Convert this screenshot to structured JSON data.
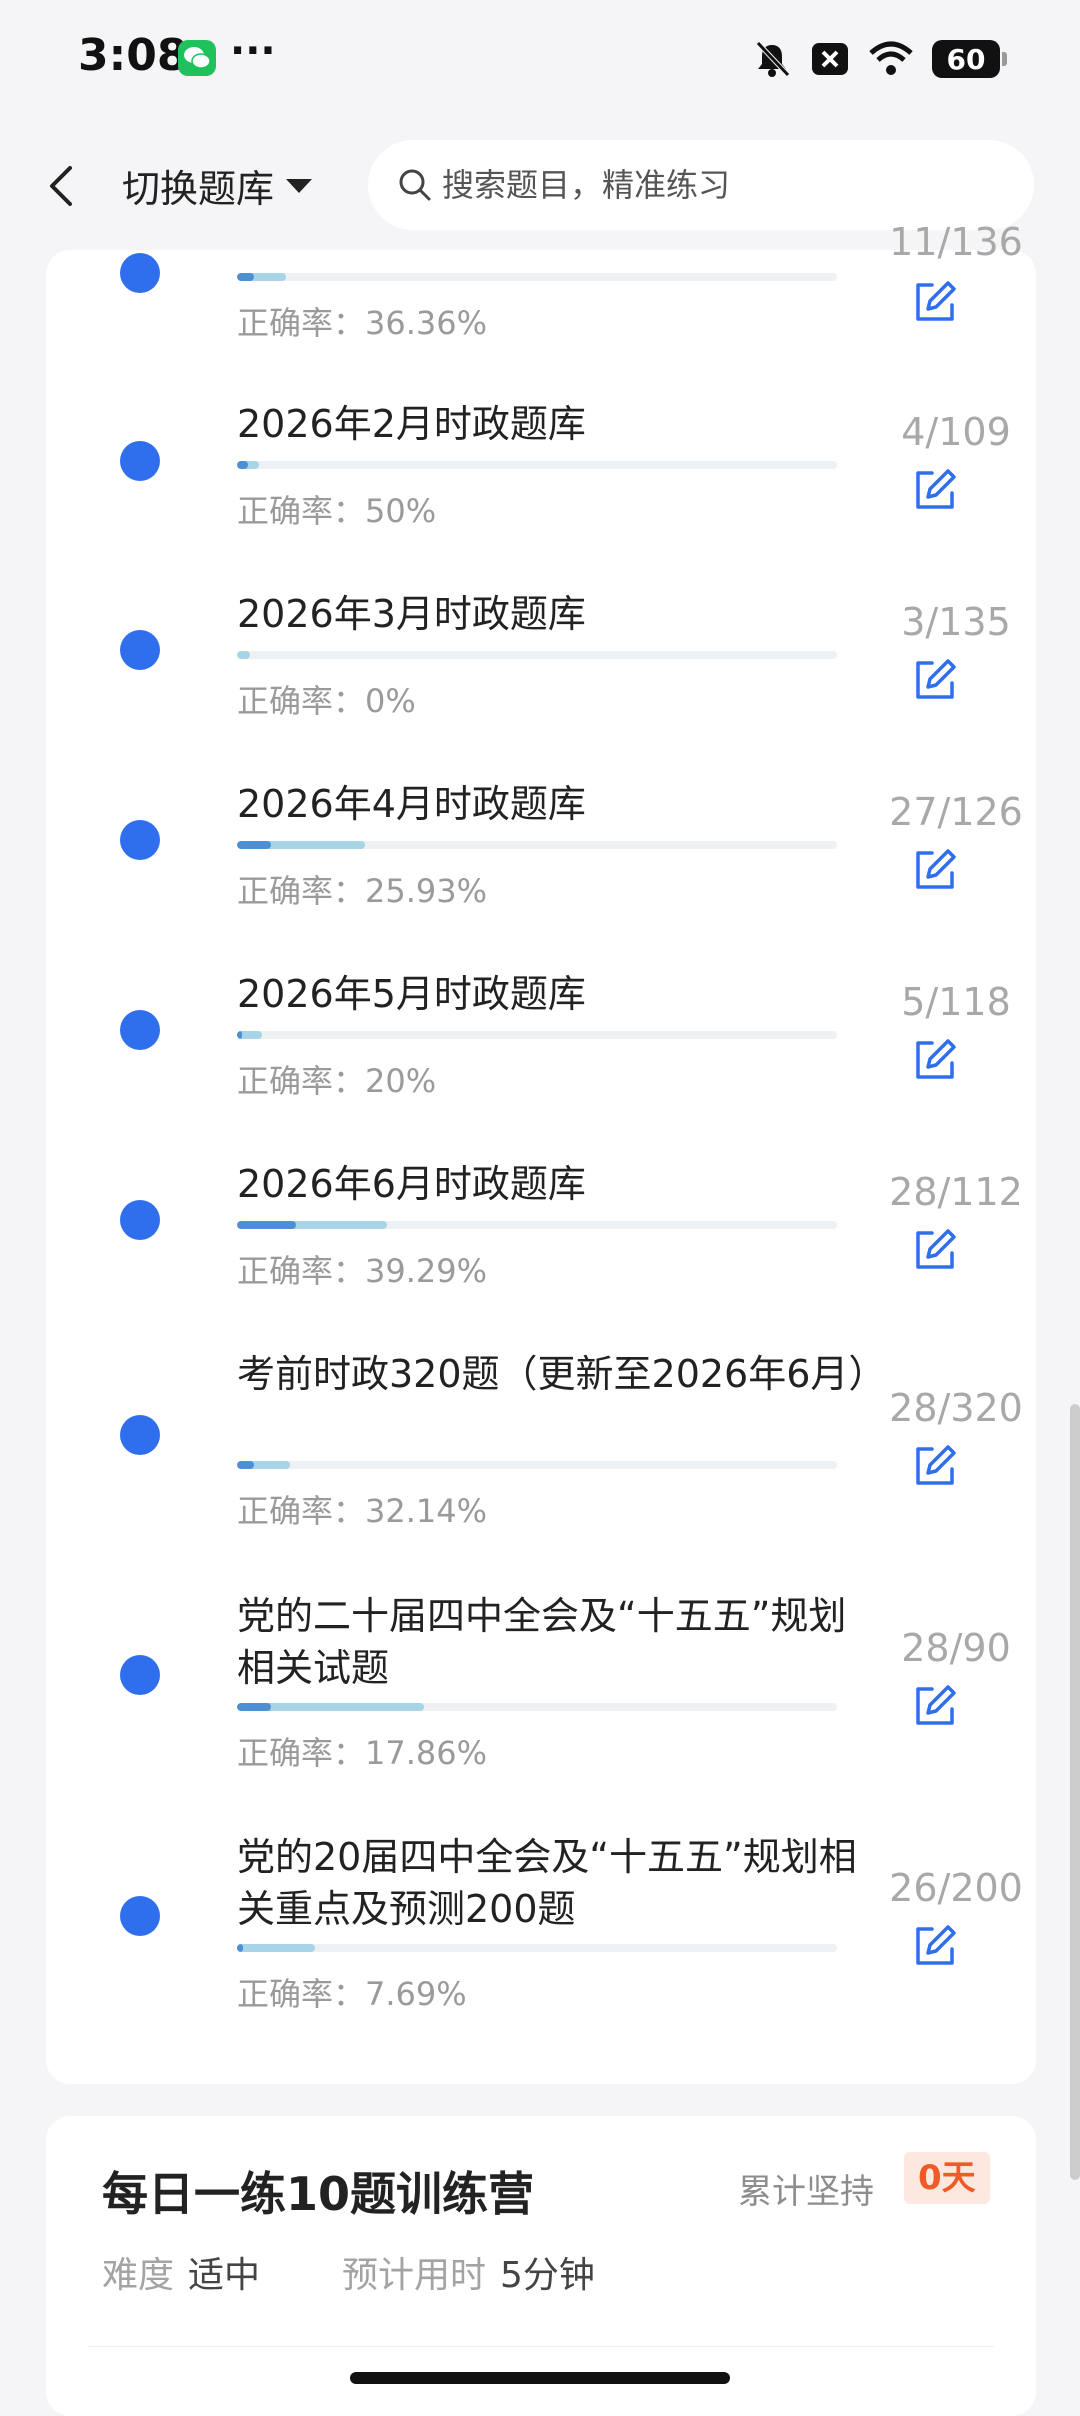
{
  "status_bar": {
    "time": "3:08",
    "more": "···",
    "battery": "60"
  },
  "header": {
    "back_icon": "chevron-left-icon",
    "switch_label": "切换题库",
    "search_placeholder": "搜索题目，精准练习"
  },
  "list": {
    "rate_prefix": "正确率：",
    "items": [
      {
        "title": "",
        "count": "11/136",
        "rate": "36.36%",
        "progress": 0.081,
        "correct": 0.029
      },
      {
        "title": "2026年2月时政题库",
        "count": "4/109",
        "rate": "50%",
        "progress": 0.037,
        "correct": 0.018
      },
      {
        "title": "2026年3月时政题库",
        "count": "3/135",
        "rate": "0%",
        "progress": 0.022,
        "correct": 0.0
      },
      {
        "title": "2026年4月时政题库",
        "count": "27/126",
        "rate": "25.93%",
        "progress": 0.214,
        "correct": 0.056
      },
      {
        "title": "2026年5月时政题库",
        "count": "5/118",
        "rate": "20%",
        "progress": 0.042,
        "correct": 0.008
      },
      {
        "title": "2026年6月时政题库",
        "count": "28/112",
        "rate": "39.29%",
        "progress": 0.25,
        "correct": 0.098
      },
      {
        "title": "考前时政320题（更新至2026年6月）",
        "count": "28/320",
        "rate": "32.14%",
        "progress": 0.0875,
        "correct": 0.028
      },
      {
        "title": "党的二十届四中全会及“十五五”规划相关试题",
        "count": "28/90",
        "rate": "17.86%",
        "progress": 0.311,
        "correct": 0.056
      },
      {
        "title": "党的20届四中全会及“十五五”规划相关重点及预测200题",
        "count": "26/200",
        "rate": "7.69%",
        "progress": 0.13,
        "correct": 0.01
      }
    ]
  },
  "camp": {
    "title": "每日一练10题训练营",
    "persist_label": "累计坚持",
    "days": "0天",
    "difficulty_label": "难度",
    "difficulty_value": "适中",
    "time_label": "预计用时",
    "time_value": "5分钟"
  }
}
